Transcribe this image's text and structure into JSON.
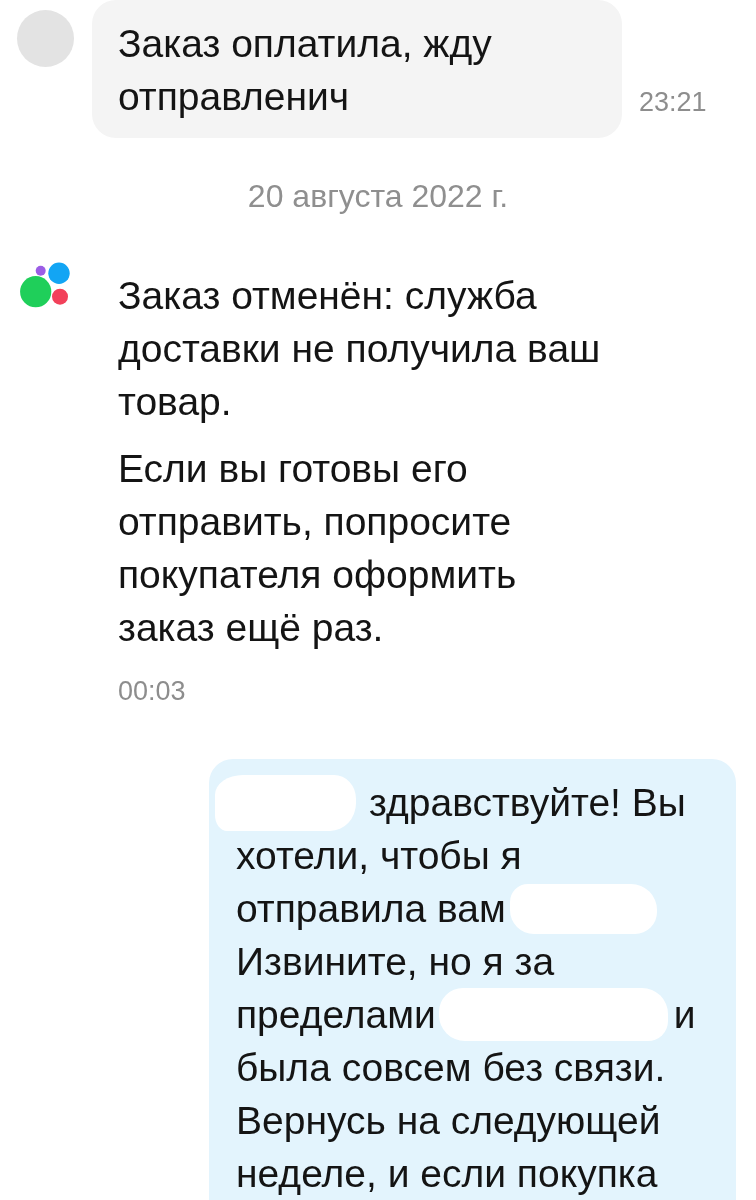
{
  "messages": [
    {
      "kind": "incoming",
      "text": "Заказ оплатила, жду отправленич",
      "time": "23:21"
    },
    {
      "kind": "date",
      "text": "20 августа 2022 г."
    },
    {
      "kind": "system",
      "paragraphs": [
        "Заказ отменён: служба доставки не получила ваш товар.",
        "Если вы готовы его отправить, попросите покупателя оформить заказ ещё раз."
      ],
      "time": "00:03"
    },
    {
      "kind": "outgoing",
      "lines": [
        {
          "parts": [
            {
              "kind": "redaction"
            },
            {
              "kind": "text",
              "text": "здравствуйте! Вы"
            }
          ]
        },
        {
          "parts": [
            {
              "kind": "text",
              "text": "хотели, чтобы я"
            }
          ]
        },
        {
          "parts": [
            {
              "kind": "text",
              "text": "отправила вам"
            },
            {
              "kind": "redaction"
            }
          ]
        },
        {
          "parts": [
            {
              "kind": "text",
              "text": "Извините, но я за"
            }
          ]
        },
        {
          "parts": [
            {
              "kind": "text",
              "text": "пределами"
            },
            {
              "kind": "redaction"
            },
            {
              "kind": "text",
              "text": "и"
            }
          ]
        },
        {
          "parts": [
            {
              "kind": "text",
              "text": "была совсем без связи."
            }
          ]
        },
        {
          "parts": [
            {
              "kind": "text",
              "text": "Вернусь на следующей"
            }
          ]
        },
        {
          "parts": [
            {
              "kind": "text",
              "text": "неделе, и если покупка"
            }
          ]
        }
      ]
    }
  ]
}
